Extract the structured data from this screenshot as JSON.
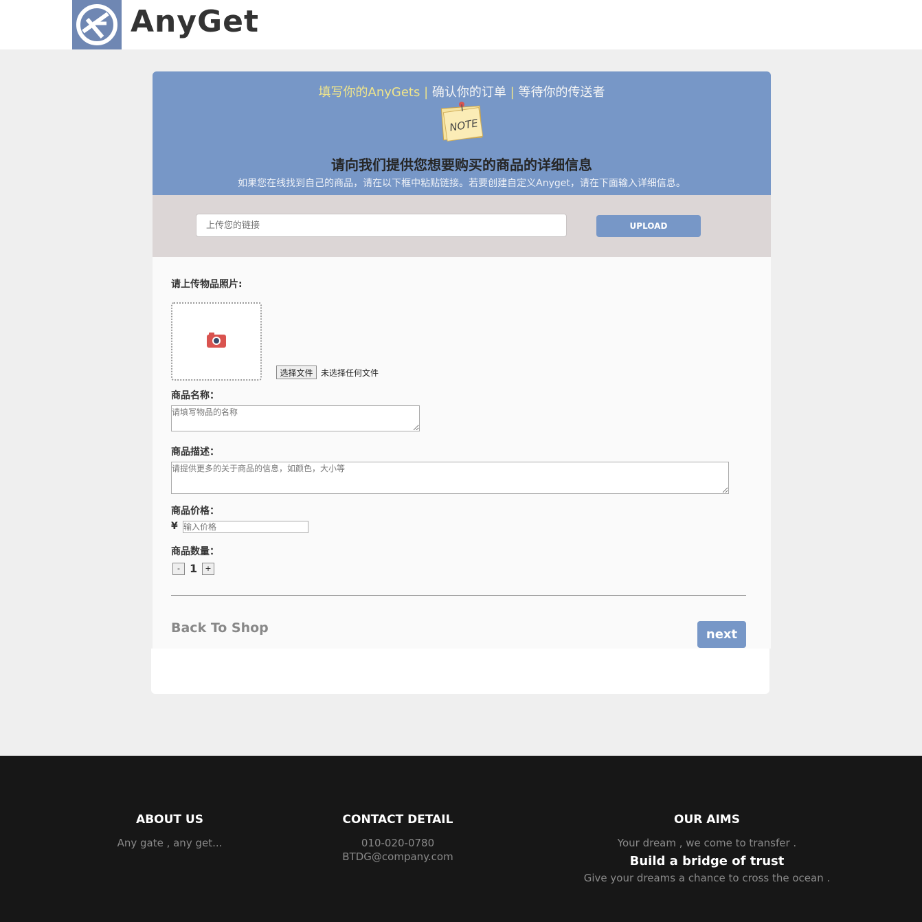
{
  "brand": {
    "name": "AnyGet",
    "logo_icon": "globe-logo-icon"
  },
  "banner": {
    "step1": "填写你的AnyGets",
    "separator": "|",
    "step2": "确认你的订单",
    "step3": "等待你的传送者",
    "note_text": "NOTE",
    "title": "请向我们提供您想要购买的商品的详细信息",
    "subtitle": "如果您在线找到自己的商品，请在以下框中粘贴链接。若要创建自定义Anyget，请在下面输入详细信息。"
  },
  "upload": {
    "link_placeholder": "上传您的链接",
    "button": "UPLOAD"
  },
  "form": {
    "photo_label": "请上传物品照片:",
    "file_button": "选择文件",
    "file_status": "未选择任何文件",
    "name_label": "商品名称：",
    "name_placeholder": "请填写物品的名称",
    "desc_label": "商品描述：",
    "desc_placeholder": "请提供更多的关于商品的信息，如颜色，大小等",
    "price_label": "商品价格：",
    "currency": "¥",
    "price_placeholder": "输入价格",
    "qty_label": "商品数量：",
    "qty_minus": "-",
    "qty_value": "1",
    "qty_plus": "+",
    "back": "Back To Shop",
    "next": "next"
  },
  "footer": {
    "about": {
      "title": "ABOUT US",
      "text": "Any gate , any get..."
    },
    "contact": {
      "title": "CONTACT DETAIL",
      "phone": "010-020-0780",
      "email": "BTDG@company.com"
    },
    "aims": {
      "title": "OUR AIMS",
      "line1": "Your dream , we come to transfer .",
      "strong": "Build a bridge of trust",
      "line2": "Give your dreams a chance to cross the ocean ."
    }
  },
  "colors": {
    "accent": "#7797c7",
    "highlight": "#f0e58a",
    "footer_bg": "#171717",
    "upload_band": "#dcd6d6"
  }
}
